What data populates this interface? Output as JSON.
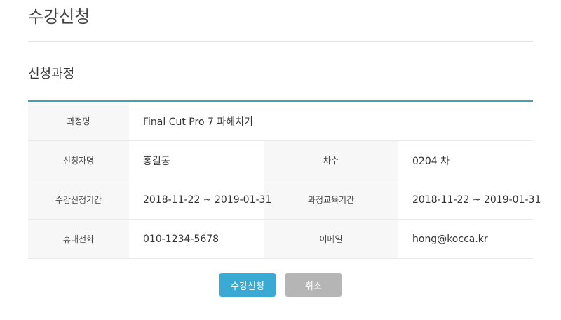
{
  "page": {
    "title": "수강신청"
  },
  "section": {
    "title": "신청과정"
  },
  "info": {
    "course_label": "과정명",
    "course_value": "Final Cut Pro 7 파헤치기",
    "applicant_label": "신청자명",
    "applicant_value": "홍길동",
    "round_label": "차수",
    "round_value": "0204 차",
    "enroll_period_label": "수강신청기간",
    "enroll_period_value": "2018-11-22 ~ 2019-01-31",
    "edu_period_label": "과정교육기간",
    "edu_period_value": "2018-11-22 ~ 2019-01-31",
    "phone_label": "휴대전화",
    "phone_value": "010-1234-5678",
    "email_label": "이메일",
    "email_value": "hong@kocca.kr"
  },
  "buttons": {
    "submit_label": "수강신청",
    "cancel_label": "취소"
  },
  "colors": {
    "accent_border": "#3aa3b8",
    "submit_button": "#3aa9d4",
    "cancel_button": "#b5b5b5",
    "label_background": "#f7f7f7"
  }
}
